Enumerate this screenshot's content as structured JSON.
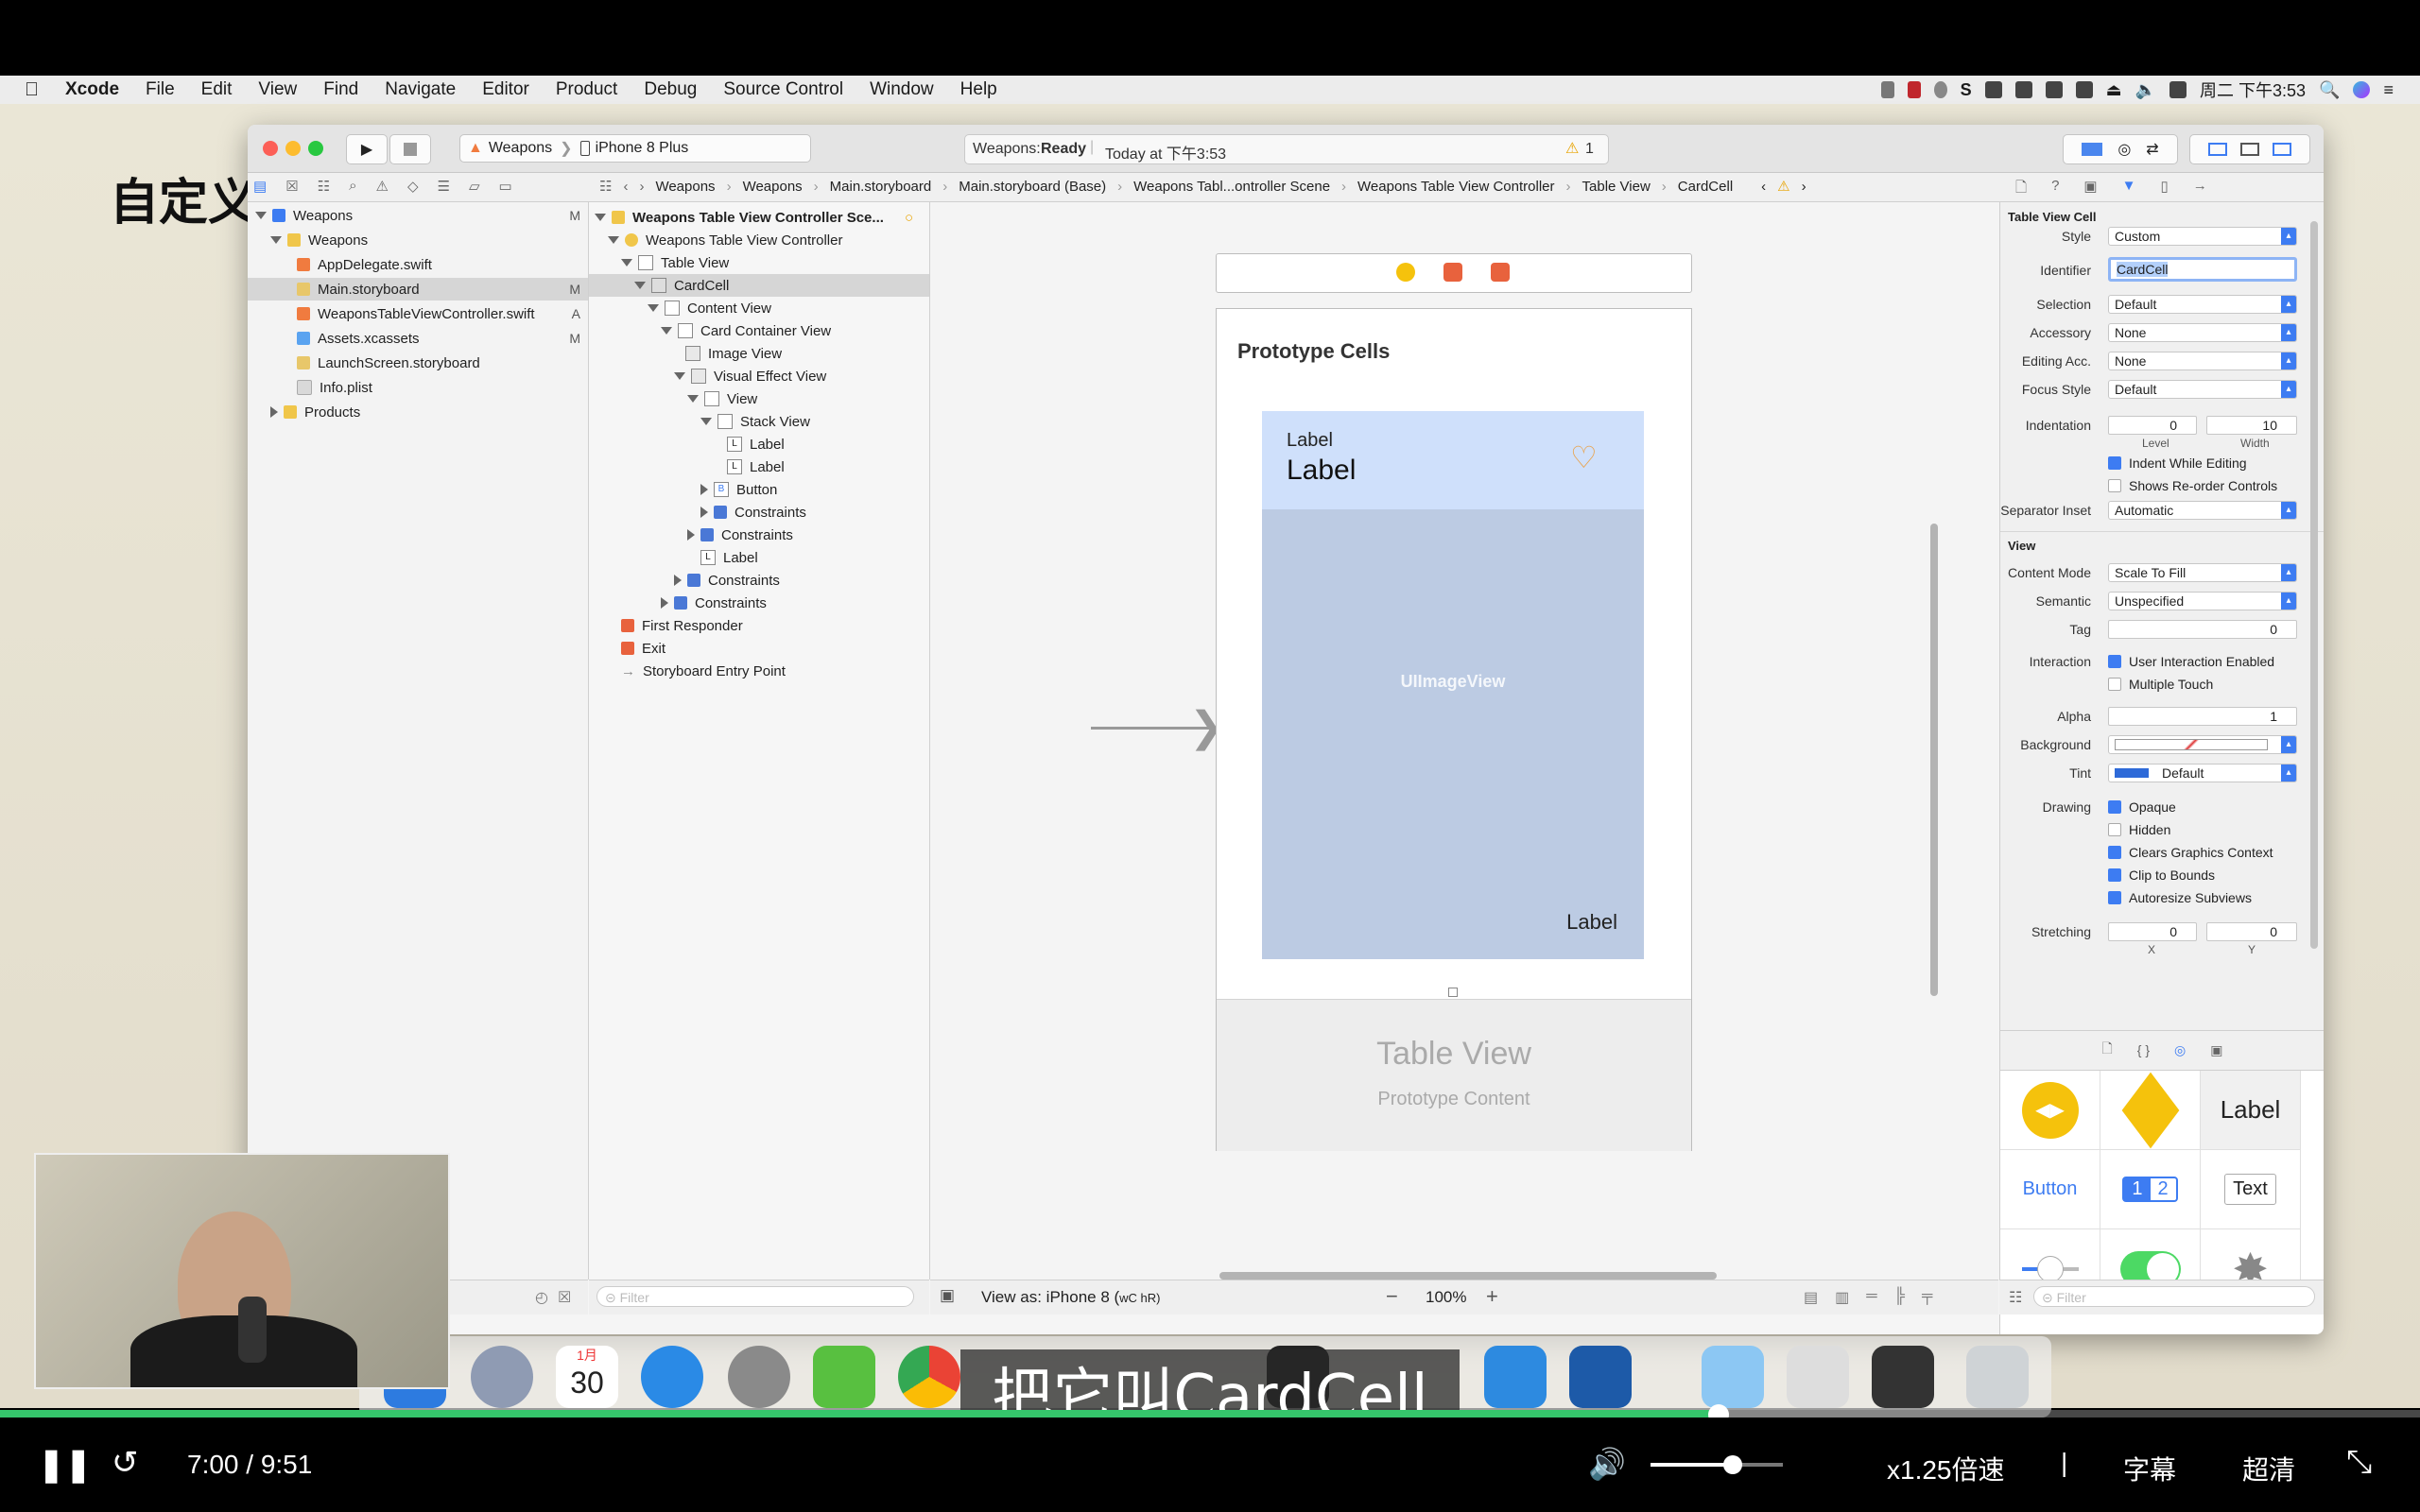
{
  "menubar": {
    "app": "Xcode",
    "items": [
      "File",
      "Edit",
      "View",
      "Find",
      "Navigate",
      "Editor",
      "Product",
      "Debug",
      "Source Control",
      "Window",
      "Help"
    ],
    "clock": "周二 下午3:53"
  },
  "slide": {
    "title_fragment": "自定义"
  },
  "toolbar": {
    "scheme": "Weapons",
    "device": "iPhone 8 Plus",
    "activity_project": "Weapons:",
    "activity_status": "Ready",
    "activity_time": "Today at 下午3:53",
    "warning_count": "1"
  },
  "jumpbar": [
    "Weapons",
    "Weapons",
    "Main.storyboard",
    "Main.storyboard (Base)",
    "Weapons Tabl...ontroller Scene",
    "Weapons Table View Controller",
    "Table View",
    "CardCell"
  ],
  "navigator": {
    "items": [
      {
        "label": "Weapons",
        "badge": "M",
        "indent": 0,
        "color": "#3d7cf2"
      },
      {
        "label": "Weapons",
        "badge": "",
        "indent": 1,
        "color": "#f0c64a"
      },
      {
        "label": "AppDelegate.swift",
        "badge": "",
        "indent": 2,
        "color": "#f07b3f"
      },
      {
        "label": "Main.storyboard",
        "badge": "M",
        "indent": 2,
        "color": "#e8c76a"
      },
      {
        "label": "WeaponsTableViewController.swift",
        "badge": "A",
        "indent": 2,
        "color": "#f07b3f"
      },
      {
        "label": "Assets.xcassets",
        "badge": "M",
        "indent": 2,
        "color": "#5aa3f0"
      },
      {
        "label": "LaunchScreen.storyboard",
        "badge": "",
        "indent": 2,
        "color": "#e8c76a"
      },
      {
        "label": "Info.plist",
        "badge": "",
        "indent": 2,
        "color": "#d9d9d9"
      },
      {
        "label": "Products",
        "badge": "",
        "indent": 1,
        "color": "#f0c64a"
      }
    ],
    "filter_placeholder": "Filter"
  },
  "outline": {
    "items": [
      "Weapons Table View Controller Sce...",
      "Weapons Table View Controller",
      "Table View",
      "CardCell",
      "Content View",
      "Card Container View",
      "Image View",
      "Visual Effect View",
      "View",
      "Stack View",
      "Label",
      "Label",
      "Button",
      "Constraints",
      "Constraints",
      "Label",
      "Constraints",
      "Constraints",
      "First Responder",
      "Exit",
      "Storyboard Entry Point"
    ],
    "filter_placeholder": "Filter"
  },
  "canvas": {
    "section_title": "Prototype Cells",
    "card_small_label": "Label",
    "card_big_label": "Label",
    "image_label": "UIImageView",
    "corner_label": "Label",
    "tv_title": "Table View",
    "tv_subtitle": "Prototype Content",
    "view_as": "View as: iPhone 8 (",
    "view_as_suffix": "wC hR)",
    "zoom": "100%"
  },
  "inspector": {
    "section": "Table View Cell",
    "style_label": "Style",
    "style_value": "Custom",
    "identifier_label": "Identifier",
    "identifier_value": "CardCell",
    "selection_label": "Selection",
    "selection_value": "Default",
    "accessory_label": "Accessory",
    "accessory_value": "None",
    "editing_label": "Editing Acc.",
    "editing_value": "None",
    "focus_label": "Focus Style",
    "focus_value": "Default",
    "indent_label": "Indentation",
    "indent_level": "0",
    "indent_width": "10",
    "level_caption": "Level",
    "width_caption": "Width",
    "indent_while_editing": "Indent While Editing",
    "reorder": "Shows Re-order Controls",
    "sep_label": "Separator Inset",
    "sep_value": "Automatic",
    "view_section": "View",
    "content_mode_label": "Content Mode",
    "content_mode_value": "Scale To Fill",
    "semantic_label": "Semantic",
    "semantic_value": "Unspecified",
    "tag_label": "Tag",
    "tag_value": "0",
    "interaction_label": "Interaction",
    "user_interaction": "User Interaction Enabled",
    "multiple_touch": "Multiple Touch",
    "alpha_label": "Alpha",
    "alpha_value": "1",
    "background_label": "Background",
    "tint_label": "Tint",
    "tint_value": "Default",
    "drawing_label": "Drawing",
    "opaque": "Opaque",
    "hidden": "Hidden",
    "clears": "Clears Graphics Context",
    "clip": "Clip to Bounds",
    "autoresize": "Autoresize Subviews",
    "stretching_label": "Stretching",
    "stretch_x": "0",
    "stretch_y": "0",
    "x_caption": "X",
    "y_caption": "Y"
  },
  "library": {
    "label_item": "Label",
    "button_item": "Button",
    "seg_1": "1",
    "seg_2": "2",
    "text_item": "Text",
    "filter_placeholder": "Filter"
  },
  "dock": {
    "calendar_day": "30",
    "calendar_month": "1月"
  },
  "subtitle": "把它叫CardCell",
  "player": {
    "time": "7:00 / 9:51",
    "progress": 0.71,
    "volume": 0.62,
    "speed": "x1.25倍速",
    "subtitles": "字幕",
    "quality": "超清",
    "separator": "|"
  }
}
